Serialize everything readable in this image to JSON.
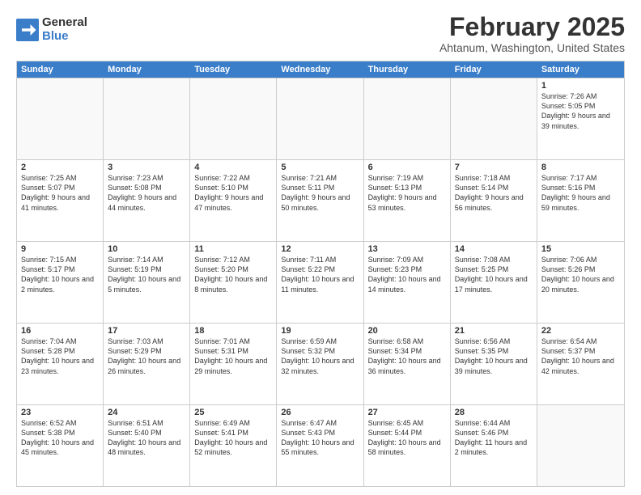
{
  "logo": {
    "general": "General",
    "blue": "Blue",
    "arrow": "▶"
  },
  "title": "February 2025",
  "subtitle": "Ahtanum, Washington, United States",
  "header_days": [
    "Sunday",
    "Monday",
    "Tuesday",
    "Wednesday",
    "Thursday",
    "Friday",
    "Saturday"
  ],
  "rows": [
    [
      {
        "day": "",
        "empty": true
      },
      {
        "day": "",
        "empty": true
      },
      {
        "day": "",
        "empty": true
      },
      {
        "day": "",
        "empty": true
      },
      {
        "day": "",
        "empty": true
      },
      {
        "day": "",
        "empty": true
      },
      {
        "day": "1",
        "info": "Sunrise: 7:26 AM\nSunset: 5:05 PM\nDaylight: 9 hours and 39 minutes."
      }
    ],
    [
      {
        "day": "2",
        "info": "Sunrise: 7:25 AM\nSunset: 5:07 PM\nDaylight: 9 hours and 41 minutes."
      },
      {
        "day": "3",
        "info": "Sunrise: 7:23 AM\nSunset: 5:08 PM\nDaylight: 9 hours and 44 minutes."
      },
      {
        "day": "4",
        "info": "Sunrise: 7:22 AM\nSunset: 5:10 PM\nDaylight: 9 hours and 47 minutes."
      },
      {
        "day": "5",
        "info": "Sunrise: 7:21 AM\nSunset: 5:11 PM\nDaylight: 9 hours and 50 minutes."
      },
      {
        "day": "6",
        "info": "Sunrise: 7:19 AM\nSunset: 5:13 PM\nDaylight: 9 hours and 53 minutes."
      },
      {
        "day": "7",
        "info": "Sunrise: 7:18 AM\nSunset: 5:14 PM\nDaylight: 9 hours and 56 minutes."
      },
      {
        "day": "8",
        "info": "Sunrise: 7:17 AM\nSunset: 5:16 PM\nDaylight: 9 hours and 59 minutes."
      }
    ],
    [
      {
        "day": "9",
        "info": "Sunrise: 7:15 AM\nSunset: 5:17 PM\nDaylight: 10 hours and 2 minutes."
      },
      {
        "day": "10",
        "info": "Sunrise: 7:14 AM\nSunset: 5:19 PM\nDaylight: 10 hours and 5 minutes."
      },
      {
        "day": "11",
        "info": "Sunrise: 7:12 AM\nSunset: 5:20 PM\nDaylight: 10 hours and 8 minutes."
      },
      {
        "day": "12",
        "info": "Sunrise: 7:11 AM\nSunset: 5:22 PM\nDaylight: 10 hours and 11 minutes."
      },
      {
        "day": "13",
        "info": "Sunrise: 7:09 AM\nSunset: 5:23 PM\nDaylight: 10 hours and 14 minutes."
      },
      {
        "day": "14",
        "info": "Sunrise: 7:08 AM\nSunset: 5:25 PM\nDaylight: 10 hours and 17 minutes."
      },
      {
        "day": "15",
        "info": "Sunrise: 7:06 AM\nSunset: 5:26 PM\nDaylight: 10 hours and 20 minutes."
      }
    ],
    [
      {
        "day": "16",
        "info": "Sunrise: 7:04 AM\nSunset: 5:28 PM\nDaylight: 10 hours and 23 minutes."
      },
      {
        "day": "17",
        "info": "Sunrise: 7:03 AM\nSunset: 5:29 PM\nDaylight: 10 hours and 26 minutes."
      },
      {
        "day": "18",
        "info": "Sunrise: 7:01 AM\nSunset: 5:31 PM\nDaylight: 10 hours and 29 minutes."
      },
      {
        "day": "19",
        "info": "Sunrise: 6:59 AM\nSunset: 5:32 PM\nDaylight: 10 hours and 32 minutes."
      },
      {
        "day": "20",
        "info": "Sunrise: 6:58 AM\nSunset: 5:34 PM\nDaylight: 10 hours and 36 minutes."
      },
      {
        "day": "21",
        "info": "Sunrise: 6:56 AM\nSunset: 5:35 PM\nDaylight: 10 hours and 39 minutes."
      },
      {
        "day": "22",
        "info": "Sunrise: 6:54 AM\nSunset: 5:37 PM\nDaylight: 10 hours and 42 minutes."
      }
    ],
    [
      {
        "day": "23",
        "info": "Sunrise: 6:52 AM\nSunset: 5:38 PM\nDaylight: 10 hours and 45 minutes."
      },
      {
        "day": "24",
        "info": "Sunrise: 6:51 AM\nSunset: 5:40 PM\nDaylight: 10 hours and 48 minutes."
      },
      {
        "day": "25",
        "info": "Sunrise: 6:49 AM\nSunset: 5:41 PM\nDaylight: 10 hours and 52 minutes."
      },
      {
        "day": "26",
        "info": "Sunrise: 6:47 AM\nSunset: 5:43 PM\nDaylight: 10 hours and 55 minutes."
      },
      {
        "day": "27",
        "info": "Sunrise: 6:45 AM\nSunset: 5:44 PM\nDaylight: 10 hours and 58 minutes."
      },
      {
        "day": "28",
        "info": "Sunrise: 6:44 AM\nSunset: 5:46 PM\nDaylight: 11 hours and 2 minutes."
      },
      {
        "day": "",
        "empty": true
      }
    ]
  ]
}
